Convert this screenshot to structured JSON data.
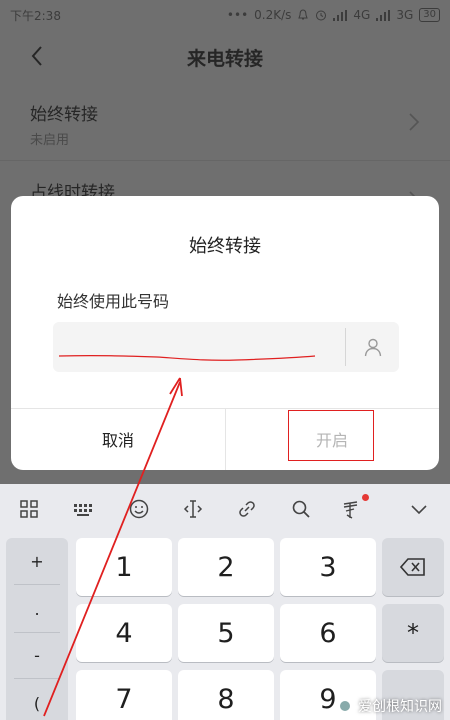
{
  "status_bar": {
    "time": "下午2:38",
    "dots": "•••",
    "speed": "0.2K/s",
    "network_1": "4G",
    "network_2": "3G",
    "battery": "30"
  },
  "header": {
    "title": "来电转接"
  },
  "settings": {
    "items": [
      {
        "label": "始终转接",
        "sub": "未启用"
      },
      {
        "label": "占线时转接"
      }
    ]
  },
  "dialog": {
    "title": "始终转接",
    "label": "始终使用此号码",
    "input_value": "",
    "cancel_label": "取消",
    "ok_label": "开启"
  },
  "keyboard": {
    "left_keys": [
      "+",
      ".",
      "-",
      "("
    ],
    "digits": [
      "1",
      "2",
      "3",
      "4",
      "5",
      "6",
      "7",
      "8",
      "9"
    ],
    "star": "*",
    "toolbar_icons": [
      "grid-icon",
      "keyboard-icon",
      "emoji-icon",
      "cursor-icon",
      "link-icon",
      "search-icon",
      "voice-icon",
      "collapse-icon"
    ]
  },
  "watermark": {
    "text": "爱创根知识网"
  },
  "colors": {
    "annotation": "#e02020",
    "dim_overlay": "#6f6f6f",
    "disabled_text": "#b5b5b5"
  }
}
